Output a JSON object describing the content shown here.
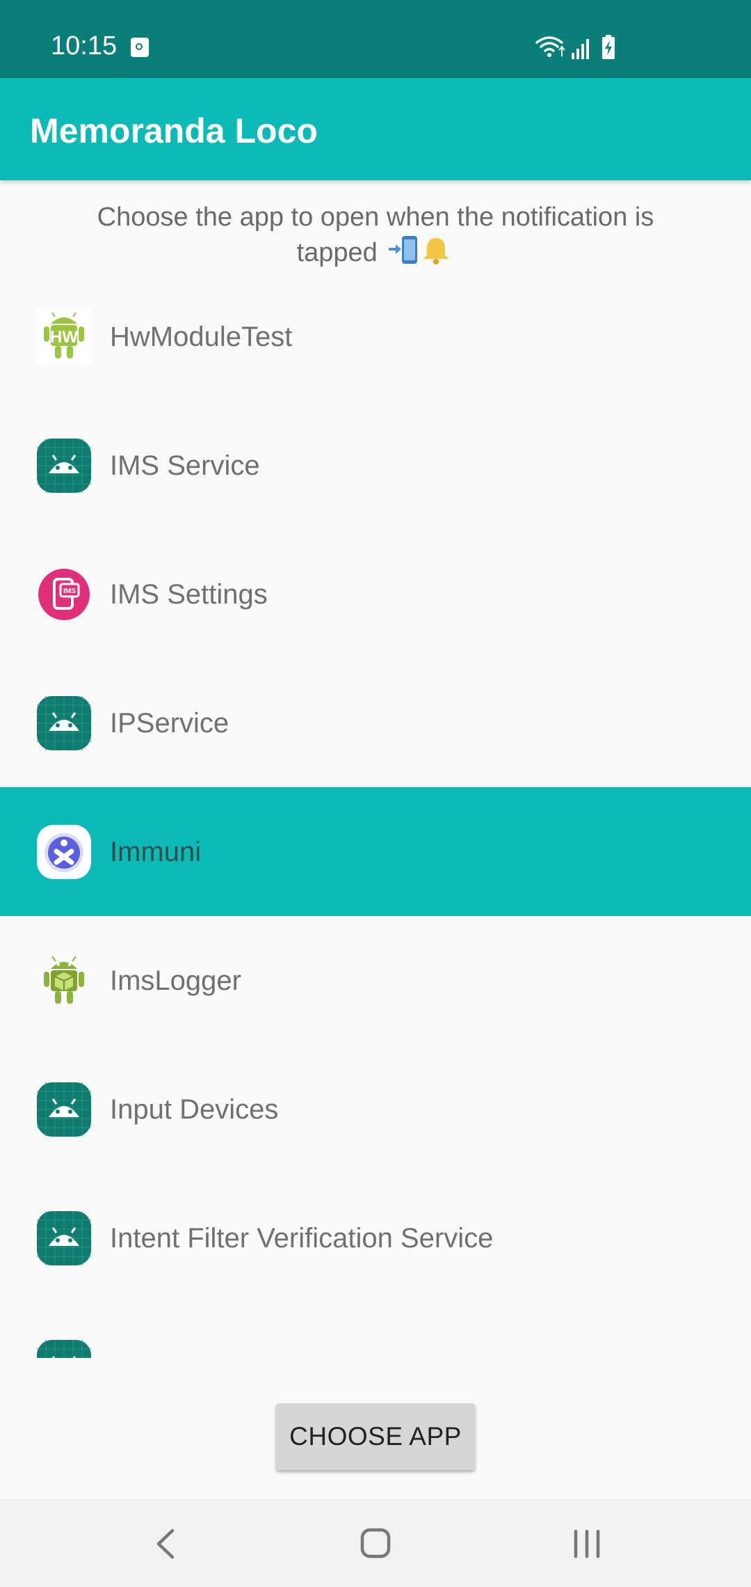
{
  "status_bar": {
    "time": "10:15",
    "icons": [
      "screenshot-icon",
      "wifi-icon",
      "signal-icon",
      "battery-charging-icon"
    ]
  },
  "app_bar": {
    "title": "Memoranda Loco"
  },
  "instruction": {
    "text": "Choose the app to open when the notification is tapped",
    "emoji_icons": [
      "phone-arrow-icon",
      "bell-icon"
    ]
  },
  "apps": [
    {
      "label": "HwModuleTest",
      "icon": "hw-android-icon",
      "selected": false
    },
    {
      "label": "IMS Service",
      "icon": "android-teal-icon",
      "selected": false
    },
    {
      "label": "IMS Settings",
      "icon": "ims-settings-icon",
      "selected": false
    },
    {
      "label": "IPService",
      "icon": "android-teal-icon",
      "selected": false
    },
    {
      "label": "Immuni",
      "icon": "immuni-icon",
      "selected": true
    },
    {
      "label": "ImsLogger",
      "icon": "android-cube-icon",
      "selected": false
    },
    {
      "label": "Input Devices",
      "icon": "android-teal-icon",
      "selected": false
    },
    {
      "label": "Intent Filter Verification Service",
      "icon": "android-teal-icon",
      "selected": false
    },
    {
      "label": "",
      "icon": "android-teal-icon",
      "selected": false
    }
  ],
  "choose_button": {
    "label": "CHOOSE APP"
  },
  "nav_bar": {
    "buttons": [
      "back-icon",
      "home-icon",
      "recents-icon"
    ]
  },
  "colors": {
    "status_bar": "#0a7e79",
    "app_bar": "#0bbab4",
    "selected_row": "#0bbab4",
    "background": "#fafafa",
    "text_gray": "#707070"
  }
}
